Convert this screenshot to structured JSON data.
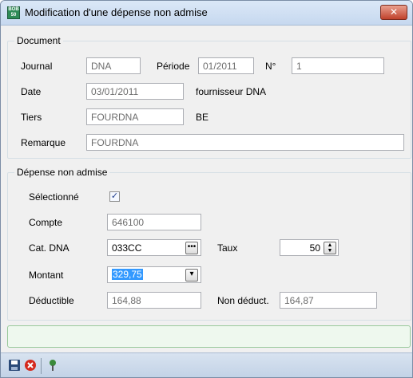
{
  "window": {
    "title": "Modification d'une dépense non admise",
    "app_icon_text": "BOB 50",
    "close_glyph": "✕"
  },
  "document": {
    "group_title": "Document",
    "journal_label": "Journal",
    "journal_value": "DNA",
    "periode_label": "Période",
    "periode_value": "01/2011",
    "numero_label": "N°",
    "numero_value": "1",
    "date_label": "Date",
    "date_value": "03/01/2011",
    "date_info": "fournisseur DNA",
    "tiers_label": "Tiers",
    "tiers_value": "FOURDNA",
    "tiers_info": "BE",
    "remarque_label": "Remarque",
    "remarque_value": "FOURDNA"
  },
  "depense": {
    "group_title": "Dépense non admise",
    "selectionne_label": "Sélectionné",
    "selectionne_checked": true,
    "compte_label": "Compte",
    "compte_value": "646100",
    "cat_label": "Cat. DNA",
    "cat_value": "033CC",
    "taux_label": "Taux",
    "taux_value": "50",
    "montant_label": "Montant",
    "montant_value": "329,75",
    "deductible_label": "Déductible",
    "deductible_value": "164,88",
    "non_deduct_label": "Non déduct.",
    "non_deduct_value": "164,87"
  },
  "status": {
    "message": ""
  },
  "toolbar": {
    "save_icon": "floppy-disk",
    "cancel_icon": "red-cancel-circle",
    "pin_icon": "pushpin"
  }
}
